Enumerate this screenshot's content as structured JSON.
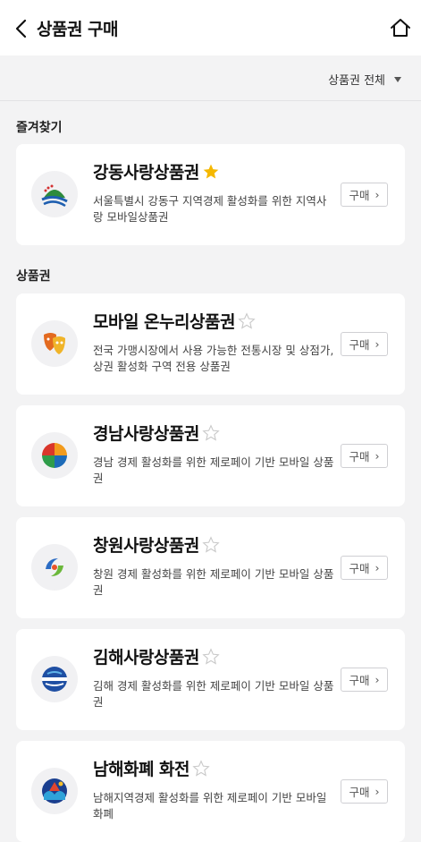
{
  "header": {
    "title": "상품권 구매"
  },
  "filter": {
    "label": "상품권 전체"
  },
  "sections": {
    "favorites_title": "즐겨찾기",
    "vouchers_title": "상품권"
  },
  "favorites": [
    {
      "title": "강동사랑상품권",
      "favorited": true,
      "desc": "서울특별시 강동구 지역경제 활성화를 위한 지역사랑 모바일상품권",
      "buy": "구매"
    }
  ],
  "vouchers": [
    {
      "title": "모바일 온누리상품권",
      "favorited": false,
      "desc": "전국 가맹시장에서 사용 가능한 전통시장 및 상점가, 상권 활성화 구역 전용 상품권",
      "buy": "구매"
    },
    {
      "title": "경남사랑상품권",
      "favorited": false,
      "desc": "경남 경제 활성화를 위한 제로페이 기반 모바일 상품권",
      "buy": "구매"
    },
    {
      "title": "창원사랑상품권",
      "favorited": false,
      "desc": "창원 경제 활성화를 위한 제로페이 기반 모바일 상품권",
      "buy": "구매"
    },
    {
      "title": "김해사랑상품권",
      "favorited": false,
      "desc": "김해 경제 활성화를 위한 제로페이 기반 모바일 상품권",
      "buy": "구매"
    },
    {
      "title": "남해화폐 화전",
      "favorited": false,
      "desc": "남해지역경제 활성화를 위한 제로페이 기반 모바일 화폐",
      "buy": "구매"
    }
  ],
  "colors": {
    "star_on": "#f5b800",
    "star_off": "#c8c8c8"
  }
}
